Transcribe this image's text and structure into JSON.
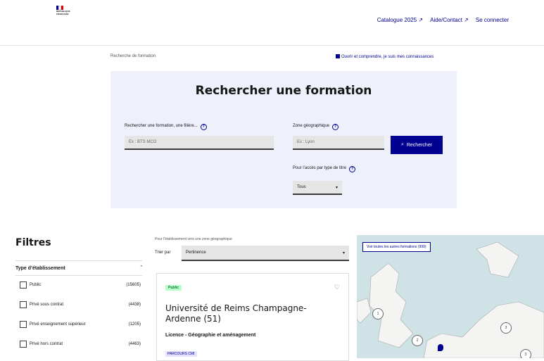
{
  "header": {
    "gov_lines": [
      "RÉPUBLIQUE",
      "FRANÇAISE"
    ],
    "tools": [
      "Catalogue 2025 ↗",
      "Aide/Contact ↗",
      "Se connecter"
    ]
  },
  "breadcrumb": "Recherche de formation",
  "exam_link": "Ouvrir et comprendre, je suis mes connaissances",
  "search": {
    "title": "Rechercher une formation",
    "formation_label": "Rechercher une formation, une filière...",
    "formation_placeholder": "Ex : BTS MCO",
    "zone_label": "Zone géographique",
    "zone_placeholder": "Ex : Lyon",
    "button": "Rechercher",
    "type_label": "Pour l’accès par type de titre",
    "type_value": "Tous"
  },
  "filters": {
    "title": "Filtres",
    "section": "Type d’établissement",
    "items": [
      {
        "label": "Public",
        "count": "(15605)"
      },
      {
        "label": "Privé sous contrat",
        "count": "(4438)"
      },
      {
        "label": "Privé enseignement supérieur",
        "count": "(1205)"
      },
      {
        "label": "Privé hors contrat",
        "count": "(4463)"
      }
    ]
  },
  "list": {
    "note": "Pour l’établissement vers une zone géographique",
    "sort_label": "Trier par",
    "sort_value": "Pertinence",
    "card": {
      "badge": "Public",
      "title": "Université de Reims Champagne-Ardenne (51)",
      "subtitle": "Licence - Géographie et aménagement",
      "tag": "PARCOURS CMI"
    }
  },
  "map": {
    "button": "Voir toutes les autres formations (999)",
    "clusters": [
      "1",
      "3",
      "2",
      "3"
    ]
  }
}
